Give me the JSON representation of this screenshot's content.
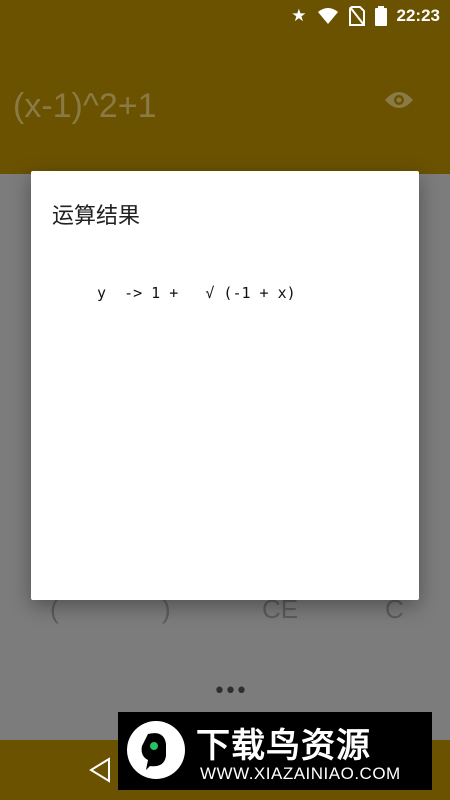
{
  "status_bar": {
    "time": "22:23",
    "icons": [
      "star-icon",
      "wifi-icon",
      "no-sim-icon",
      "battery-icon"
    ]
  },
  "app": {
    "expression": "(x-1)^2+1",
    "keys_partial": [
      "(",
      ")",
      "CE",
      "C"
    ],
    "more_menu": "•••"
  },
  "dialog": {
    "title": "运算结果",
    "result": "y  -> 1 +   √ (-1 + x)"
  },
  "watermark": {
    "title": "下载鸟资源",
    "url": "WWW.XIAZAINIAO.COM"
  },
  "colors": {
    "primary": "#6b5200",
    "scrim_body": "#7c7c7c",
    "dialog_bg": "#ffffff"
  }
}
